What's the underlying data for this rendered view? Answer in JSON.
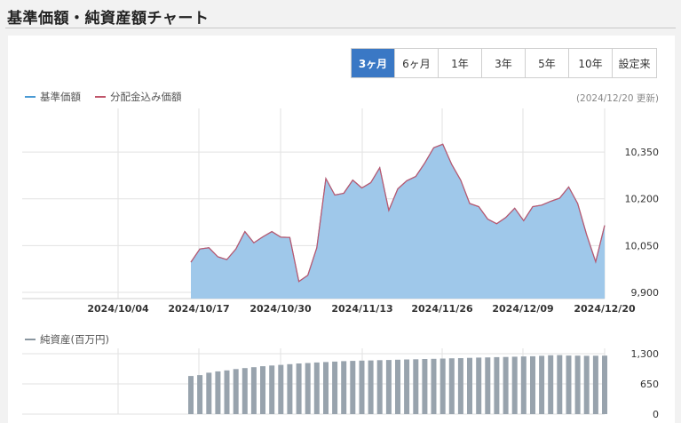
{
  "page": {
    "title": "基準価額・純資産額チャート"
  },
  "periods": [
    {
      "label": "3ヶ月",
      "active": true
    },
    {
      "label": "6ヶ月",
      "active": false
    },
    {
      "label": "1年",
      "active": false
    },
    {
      "label": "3年",
      "active": false
    },
    {
      "label": "5年",
      "active": false
    },
    {
      "label": "10年",
      "active": false
    },
    {
      "label": "設定来",
      "active": false
    }
  ],
  "legend": {
    "nav_label": "基準価額",
    "nav_color": "#4a9ad4",
    "dist_label": "分配金込み価額",
    "dist_color": "#c0566b"
  },
  "updated_text": "(2024/12/20 更新)",
  "net_assets_legend": "純資産(百万円)",
  "colors": {
    "area_fill": "#9fc8ea",
    "bar_fill": "#98a3ad",
    "active_button": "#3a78c5"
  },
  "chart_data": [
    {
      "type": "area",
      "title": "",
      "series": [
        {
          "name": "基準価額"
        },
        {
          "name": "分配金込み価額"
        }
      ],
      "x_ticks": [
        "2024/10/04",
        "2024/10/17",
        "2024/10/30",
        "2024/11/13",
        "2024/11/26",
        "2024/12/09",
        "2024/12/20"
      ],
      "y_ticks": [
        9900,
        10050,
        10200,
        10350
      ],
      "y_tick_labels": [
        "9,900",
        "10,050",
        "10,200",
        "10,350"
      ],
      "ylim": [
        9880,
        10490
      ],
      "grid": true,
      "values": [
        9997,
        10039,
        10043,
        10014,
        10005,
        10039,
        10095,
        10059,
        10078,
        10095,
        10077,
        10076,
        9935,
        9955,
        10043,
        10265,
        10212,
        10218,
        10260,
        10235,
        10252,
        10300,
        10163,
        10232,
        10258,
        10272,
        10315,
        10364,
        10375,
        10310,
        10260,
        10185,
        10175,
        10135,
        10120,
        10140,
        10170,
        10130,
        10175,
        10180,
        10192,
        10202,
        10238,
        10185,
        10085,
        9998,
        10115
      ]
    },
    {
      "type": "bar",
      "title": "",
      "series": [
        {
          "name": "純資産(百万円)"
        }
      ],
      "y_ticks": [
        0,
        650,
        1300
      ],
      "y_tick_labels": [
        "0",
        "650",
        "1,300"
      ],
      "ylim": [
        0,
        1300
      ],
      "grid": true,
      "values": [
        820,
        840,
        890,
        920,
        940,
        970,
        990,
        1010,
        1030,
        1045,
        1060,
        1075,
        1090,
        1100,
        1110,
        1120,
        1130,
        1140,
        1145,
        1150,
        1155,
        1160,
        1165,
        1170,
        1175,
        1180,
        1185,
        1190,
        1195,
        1200,
        1205,
        1210,
        1215,
        1220,
        1225,
        1230,
        1235,
        1240,
        1245,
        1255,
        1265,
        1270,
        1260,
        1258,
        1255,
        1256,
        1258
      ]
    }
  ]
}
